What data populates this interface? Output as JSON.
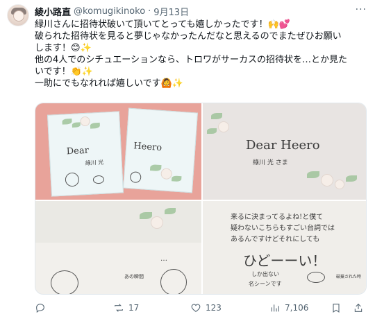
{
  "author": {
    "name": "綾小路直",
    "handle": "@komugikinoko",
    "dot": "·",
    "date": "9月13日"
  },
  "more_label": "···",
  "tweet": {
    "line1": "緑川さんに招待状破いて頂いてとっても嬉しかったです！",
    "line2": "破られた招待状を見ると夢じゃなかったんだなと思えるのでまたぜひお願い",
    "line3": "します！",
    "line4": "他の4人でのシチュエーションなら、トロワがサーカスの招待状を…とか見た",
    "line5": "いです！",
    "line6": "一助にでもなれれば嬉しいです"
  },
  "emojis": {
    "raise_hands": "🙌",
    "hearts": "💕",
    "smile": "😊",
    "sparkles": "✨",
    "clap": "👏",
    "person": "🙆"
  },
  "images": {
    "img1_dear": "Dear",
    "img1_heero": "Heero",
    "img1_name": "綠川 光",
    "img2_dear": "Dear Heero",
    "img2_name": "綠川 光 さま",
    "img3_dots": "…",
    "img3_note": "あの瞬間",
    "img4_line1": "来るに決まってるよね!と僕て",
    "img4_line2": "疑わないこちらもすごい台詞では",
    "img4_line3": "あるんですけどそれにしても",
    "img4_big": "ひどーーい！",
    "img4_small1": "しか出ない",
    "img4_small2": "名シーンです",
    "img4_note": "破棄された時"
  },
  "actions": {
    "reply_count": "",
    "retweet_count": "17",
    "like_count": "123",
    "views_count": "7,106"
  },
  "colors": {
    "text": "#0f1419",
    "secondary": "#536471",
    "envelope_bg": "#e8a39a"
  }
}
